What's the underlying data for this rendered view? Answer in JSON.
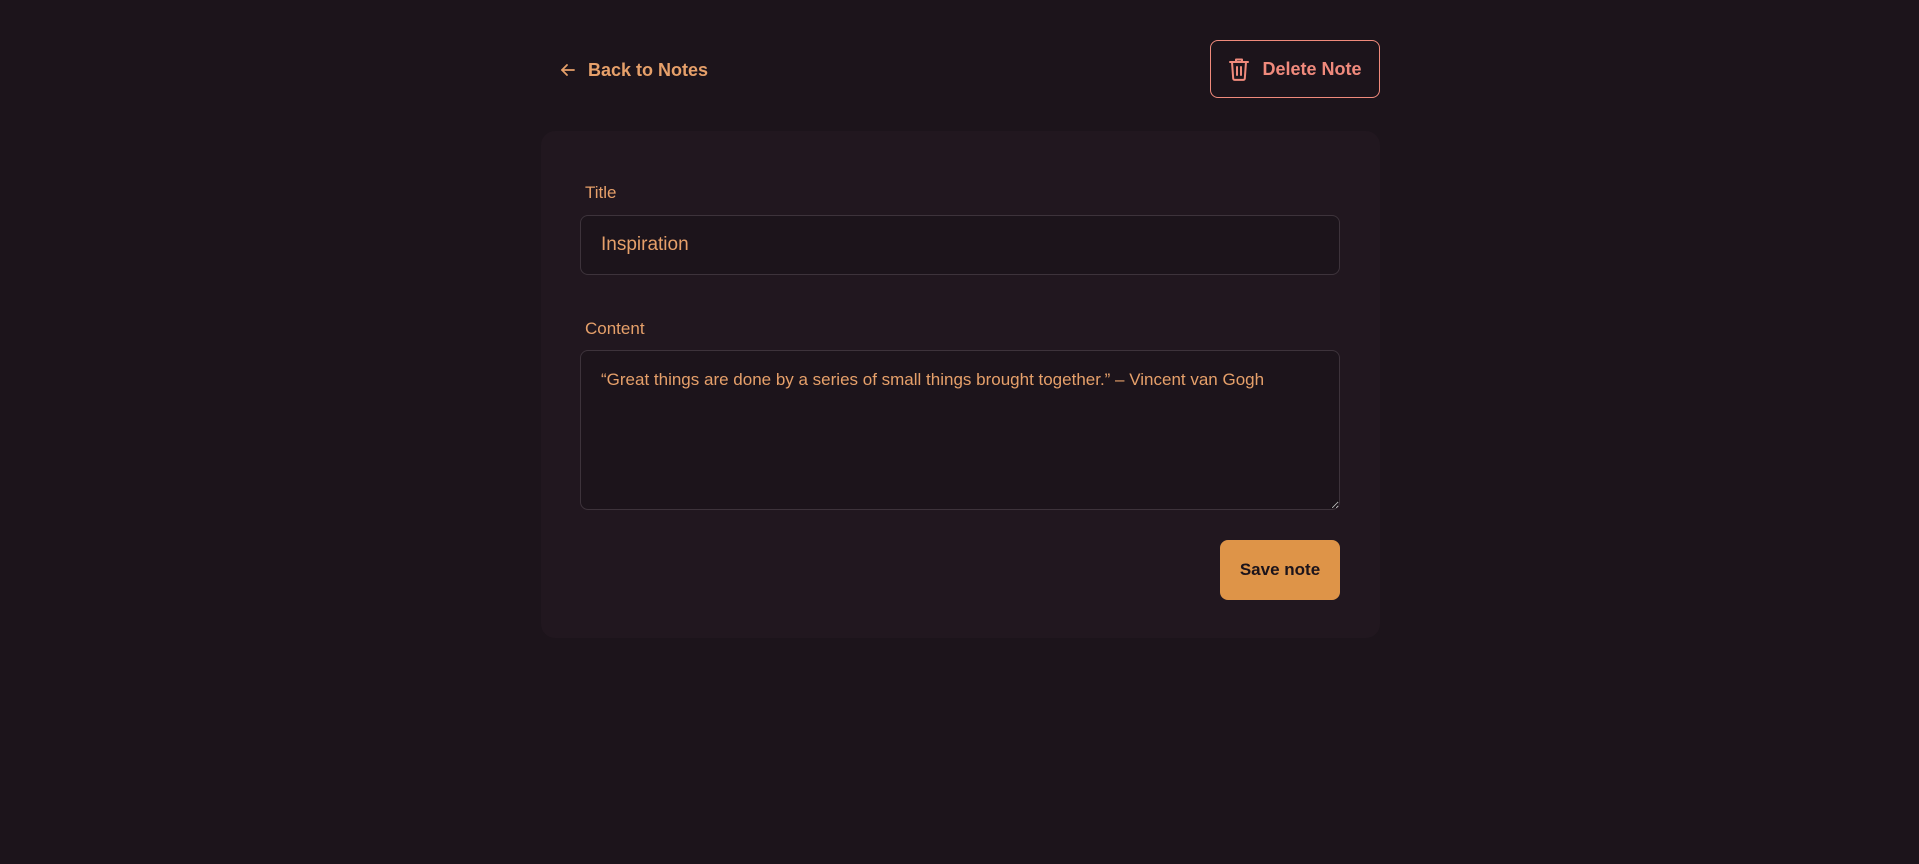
{
  "nav": {
    "back_label": "Back to Notes",
    "back_icon": "arrow-left-icon"
  },
  "actions": {
    "delete_label": "Delete Note",
    "delete_icon": "trash-icon",
    "save_label": "Save note"
  },
  "form": {
    "title_label": "Title",
    "title_value": "Inspiration",
    "content_label": "Content",
    "content_value": "“Great things are done by a series of small things brought together.” – Vincent van Gogh"
  },
  "colors": {
    "background": "#1c141b",
    "card": "#21171f",
    "accent": "#e6a06a",
    "danger": "#f08a7c",
    "primary_button": "#de9448"
  }
}
